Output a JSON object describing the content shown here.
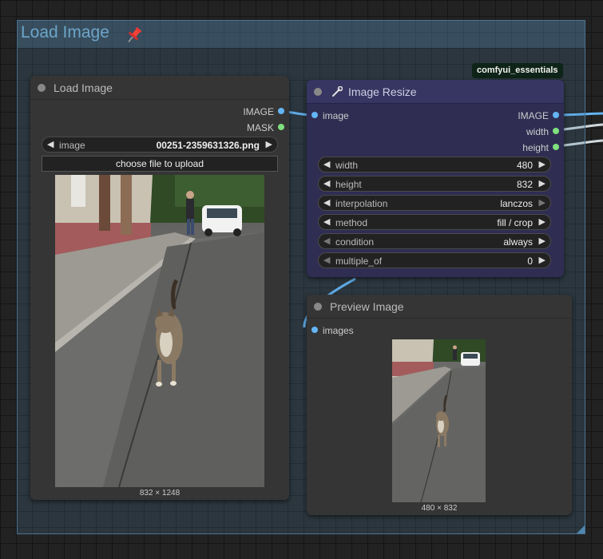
{
  "group": {
    "title": "Load Image",
    "pin_icon": "pushpin-icon"
  },
  "load_image": {
    "title": "Load Image",
    "outputs": [
      "IMAGE",
      "MASK"
    ],
    "image_widget": {
      "name": "image",
      "value": "00251-2359631326.png"
    },
    "upload_button": "choose file to upload",
    "caption": "832 × 1248"
  },
  "resize": {
    "badge": "comfyui_essentials",
    "title": "Image Resize",
    "title_icon": "wrench-icon",
    "input": "image",
    "outputs": [
      "IMAGE",
      "width",
      "height"
    ],
    "widgets": [
      {
        "name": "width",
        "value": "480"
      },
      {
        "name": "height",
        "value": "832"
      },
      {
        "name": "interpolation",
        "value": "lanczos"
      },
      {
        "name": "method",
        "value": "fill / crop"
      },
      {
        "name": "condition",
        "value": "always"
      },
      {
        "name": "multiple_of",
        "value": "0"
      }
    ]
  },
  "preview": {
    "title": "Preview Image",
    "input": "images",
    "caption": "480 × 832"
  },
  "colors": {
    "image_slot": "#64b5f6",
    "int_slot": "#7ee07e",
    "resize_node_bg": "#2f2d52",
    "group_title": "#6ea5c9"
  }
}
